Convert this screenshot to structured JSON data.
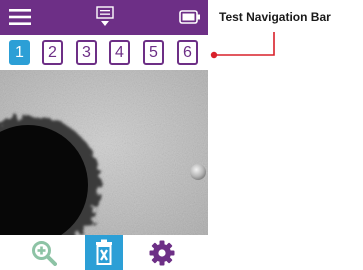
{
  "colors": {
    "topbar": "#6d2f86",
    "tab_active": "#2c9fd6",
    "tab_inactive_border": "#6d2f86",
    "callout_line": "#d9202a",
    "zoom_icon": "#8dc3a5",
    "delete_icon": "#2c9fd6",
    "settings_icon": "#6d2f86"
  },
  "topbar": {
    "icons": [
      "menu-icon",
      "list-dropdown-icon",
      "battery-icon"
    ]
  },
  "test_tabs": [
    {
      "label": "1",
      "active": true
    },
    {
      "label": "2",
      "active": false
    },
    {
      "label": "3",
      "active": false
    },
    {
      "label": "4",
      "active": false
    },
    {
      "label": "5",
      "active": false
    },
    {
      "label": "6",
      "active": false
    }
  ],
  "bottom_bar": {
    "icons": [
      "zoom-in-icon",
      "delete-icon",
      "settings-icon"
    ]
  },
  "callout": {
    "label": "Test Navigation Bar"
  }
}
